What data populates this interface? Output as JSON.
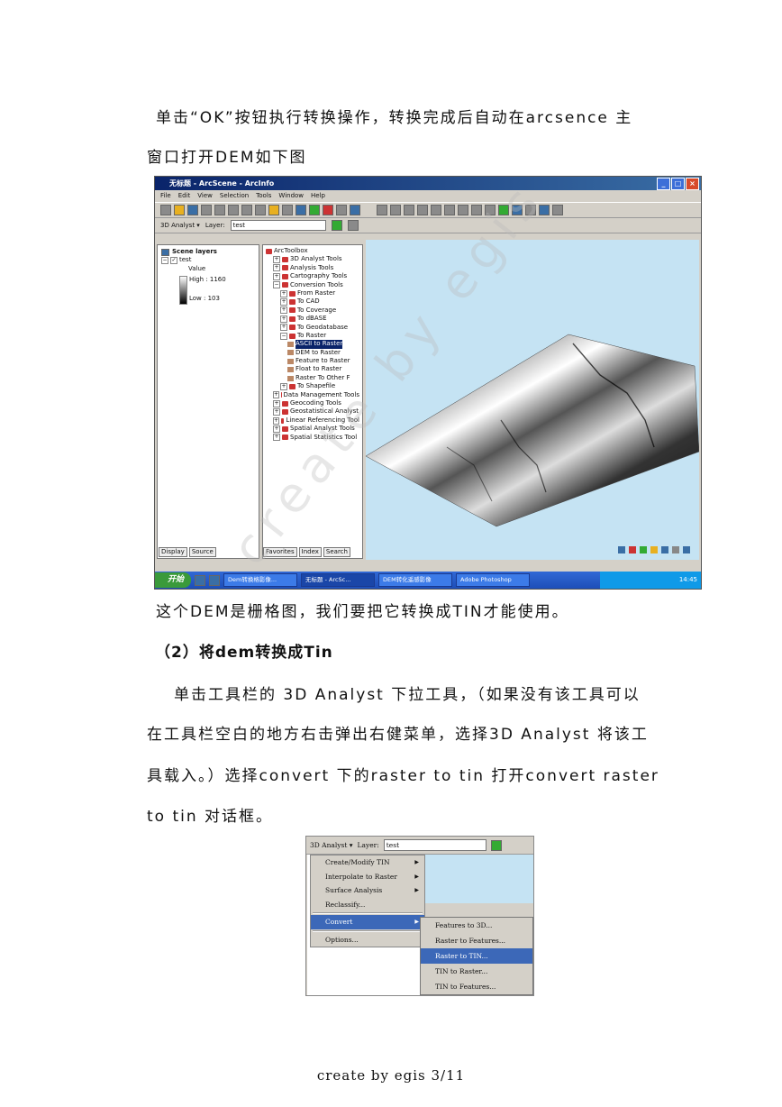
{
  "doc": {
    "para1_line1": "单击“OK”按钮执行转换操作，转换完成后自动在arcsence 主",
    "para1_line2": "窗口打开DEM如下图",
    "para2": "这个DEM是栅格图，我们要把它转换成TIN才能使用。",
    "heading": "（2）将dem转换成Tin",
    "para3_line1": "单击工具栏的 3D Analyst  下拉工具，（如果没有该工具可以",
    "para3_line2": "在工具栏空白的地方右击弹出右健菜单，选择3D Analyst 将该工",
    "para3_line3": "具载入。）选择convert 下的raster to tin 打开convert raster",
    "para3_line4": "to tin 对话框。",
    "footer": "create  by egis 3/11",
    "watermark": "create by egis"
  },
  "screenshot1": {
    "window_title": "无标题 - ArcScene - ArcInfo",
    "menu": [
      "File",
      "Edit",
      "View",
      "Selection",
      "Tools",
      "Window",
      "Help"
    ],
    "analyst_dropdown": "3D Analyst ▾",
    "layer_label": "Layer:",
    "layer_value": "test",
    "toc": {
      "root": "Scene layers",
      "layer": "test",
      "value_label": "Value",
      "high": "High : 1160",
      "low": "Low : 103"
    },
    "toc_tabs": [
      "Display",
      "Source"
    ],
    "toolbox": [
      {
        "label": "ArcToolbox",
        "level": 0,
        "kind": "root"
      },
      {
        "label": "3D Analyst Tools",
        "level": 1,
        "kind": "box"
      },
      {
        "label": "Analysis Tools",
        "level": 1,
        "kind": "box"
      },
      {
        "label": "Cartography Tools",
        "level": 1,
        "kind": "box"
      },
      {
        "label": "Conversion Tools",
        "level": 1,
        "kind": "box"
      },
      {
        "label": "From Raster",
        "level": 2,
        "kind": "box"
      },
      {
        "label": "To CAD",
        "level": 2,
        "kind": "box"
      },
      {
        "label": "To Coverage",
        "level": 2,
        "kind": "box"
      },
      {
        "label": "To dBASE",
        "level": 2,
        "kind": "box"
      },
      {
        "label": "To Geodatabase",
        "level": 2,
        "kind": "box"
      },
      {
        "label": "To Raster",
        "level": 2,
        "kind": "box"
      },
      {
        "label": "ASCII to Raster",
        "level": 3,
        "kind": "tool",
        "selected": true
      },
      {
        "label": "DEM to Raster",
        "level": 3,
        "kind": "tool"
      },
      {
        "label": "Feature to Raster",
        "level": 3,
        "kind": "tool"
      },
      {
        "label": "Float to Raster",
        "level": 3,
        "kind": "tool"
      },
      {
        "label": "Raster To Other F",
        "level": 3,
        "kind": "tool"
      },
      {
        "label": "To Shapefile",
        "level": 2,
        "kind": "box"
      },
      {
        "label": "Data Management Tools",
        "level": 1,
        "kind": "box"
      },
      {
        "label": "Geocoding Tools",
        "level": 1,
        "kind": "box"
      },
      {
        "label": "Geostatistical Analyst",
        "level": 1,
        "kind": "box"
      },
      {
        "label": "Linear Referencing Tool",
        "level": 1,
        "kind": "box"
      },
      {
        "label": "Spatial Analyst Tools",
        "level": 1,
        "kind": "box"
      },
      {
        "label": "Spatial Statistics Tool",
        "level": 1,
        "kind": "box"
      }
    ],
    "toolbox_tabs": [
      "Favorites",
      "Index",
      "Search"
    ],
    "taskbar": {
      "start": "开始",
      "tasks": [
        "Dem转换格影像...",
        "无标题 - ArcSc...",
        "DEM转化遥感影像",
        "Adobe Photoshop"
      ],
      "clock": "14:45"
    }
  },
  "screenshot2": {
    "analyst_dropdown": "3D Analyst ▾",
    "layer_label": "Layer:",
    "layer_value": "test",
    "menu_items": [
      "Create/Modify TIN",
      "Interpolate to Raster",
      "Surface Analysis",
      "Reclassify...",
      "Convert",
      "Options..."
    ],
    "submenu_items": [
      "Features to 3D...",
      "Raster to Features...",
      "Raster to TIN...",
      "TIN to Raster...",
      "TIN to Features..."
    ],
    "highlighted_menu": "Convert",
    "highlighted_submenu": "Raster to TIN..."
  },
  "colors": {
    "scene_bg": "#c5e3f3",
    "xp_title": "#0a246a",
    "highlight": "#3c68b8"
  }
}
